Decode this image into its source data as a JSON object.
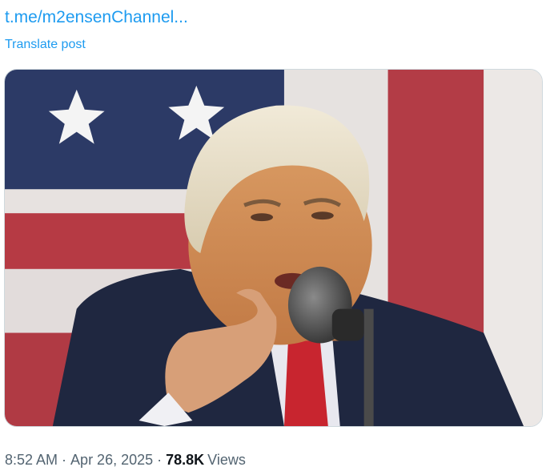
{
  "post": {
    "link_text": "t.me/m2ensenChannel...",
    "translate_label": "Translate post",
    "media": {
      "description_icon": "photo-icon"
    },
    "meta": {
      "time": "8:52 AM",
      "separator": "·",
      "date": "Apr 26, 2025",
      "views_count": "78.8K",
      "views_label": "Views"
    }
  },
  "colors": {
    "link": "#1d9bf0",
    "secondary_text": "#536471",
    "primary_text": "#0f1419",
    "border": "#cfd9de"
  }
}
